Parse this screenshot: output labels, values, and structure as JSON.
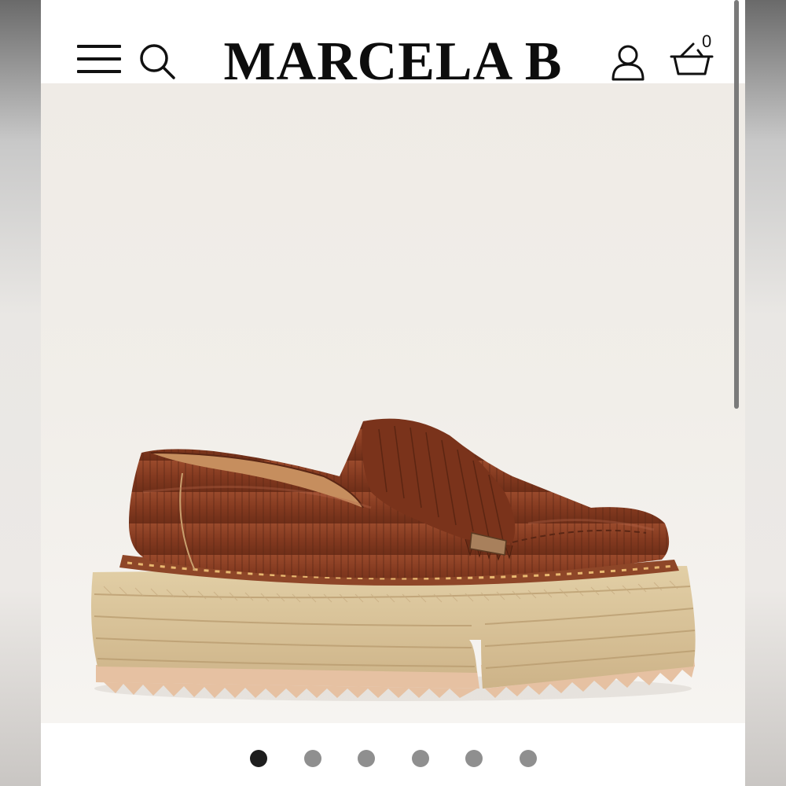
{
  "header": {
    "logo": "MARCELA B",
    "cart_count": "0"
  },
  "icons": {
    "menu": "hamburger-menu-icon",
    "search": "search-icon",
    "account": "user-icon",
    "cart": "shopping-basket-icon"
  },
  "gallery": {
    "slide_count": 6,
    "active_slide": 1
  },
  "colors": {
    "leather": "#8a3d22",
    "espadrille": "#d9c39a",
    "sole": "#e8c4a6",
    "background": "#efebe6",
    "dot_active": "#1e1e1e",
    "dot_inactive": "#8f8f8f"
  }
}
